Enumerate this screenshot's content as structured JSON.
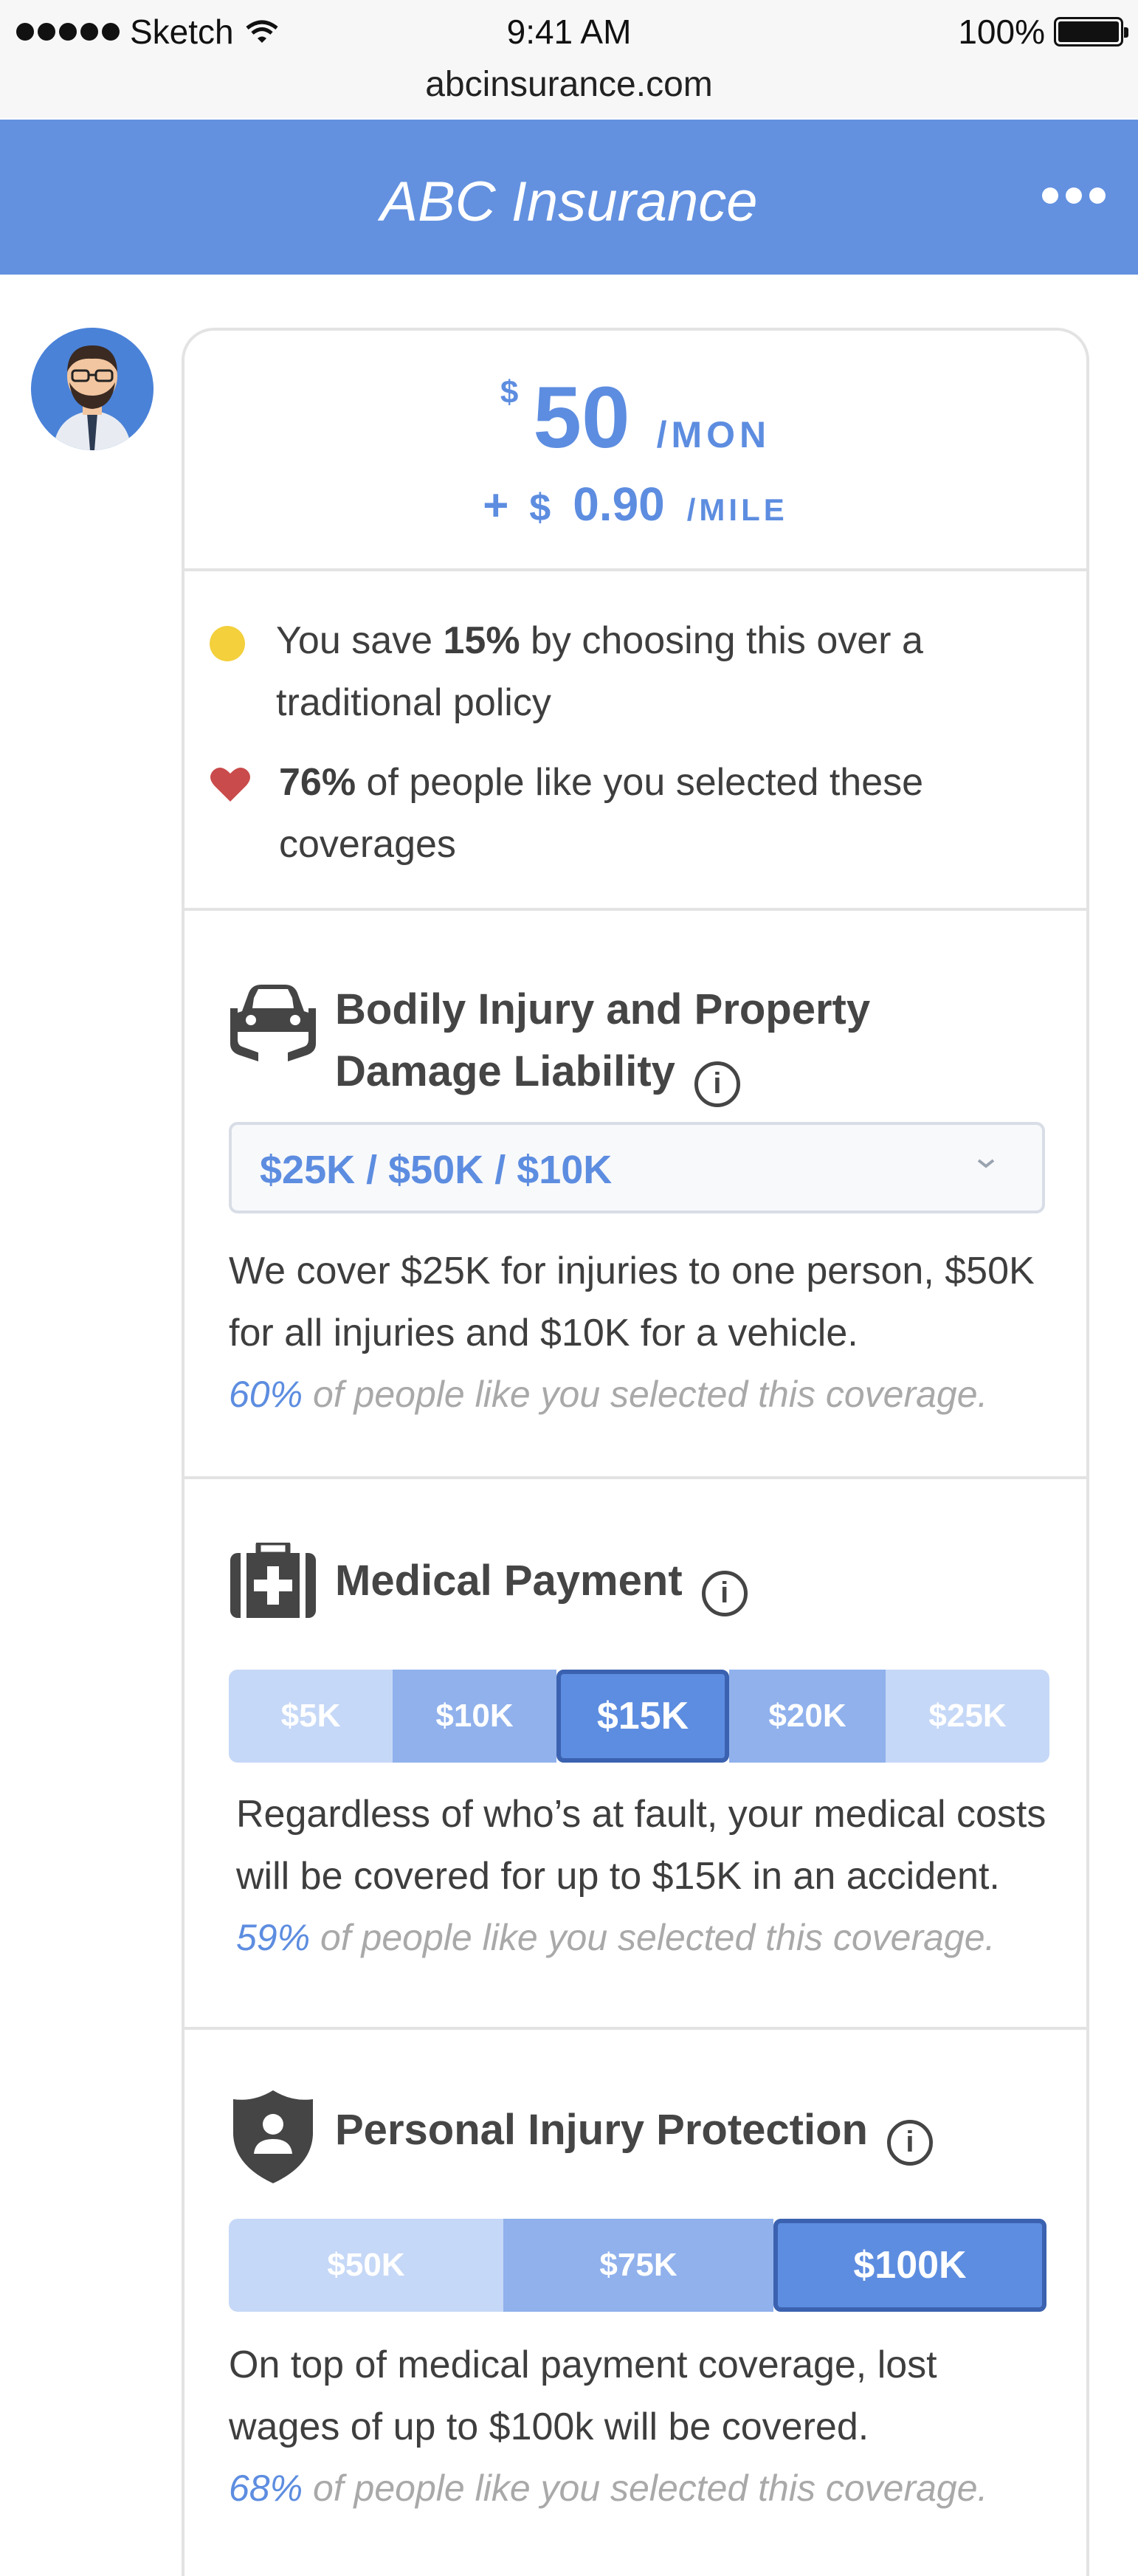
{
  "status_bar": {
    "carrier": "Sketch",
    "time": "9:41 AM",
    "battery": "100%"
  },
  "browser": {
    "url": "abcinsurance.com"
  },
  "header": {
    "title": "ABC Insurance"
  },
  "price": {
    "currency": "$",
    "monthly_amount": "50",
    "monthly_unit": "/MON",
    "plus": "+",
    "mile_currency": "$",
    "mile_amount": "0.90",
    "mile_unit": "/MILE"
  },
  "savings": {
    "save_pre": "You save ",
    "save_pct": "15%",
    "save_post": " by choosing this over a traditional policy",
    "popular_pct": "76%",
    "popular_post": " of people like you selected these coverages"
  },
  "coverages": [
    {
      "title": "Bodily Injury and Property Damage Liability",
      "selected": "$25K / $50K / $10K",
      "description": "We cover $25K for injuries to one person, $50K for all injuries and $10K for a vehicle.",
      "pct": "60%",
      "pct_text": " of people like you selected this coverage."
    },
    {
      "title": "Medical Payment",
      "options": [
        "$5K",
        "$10K",
        "$15K",
        "$20K",
        "$25K"
      ],
      "selected": "$15K",
      "description": "Regardless of who’s at fault, your medical costs will be covered for up to $15K in an accident.",
      "pct": "59%",
      "pct_text": " of people like you selected this coverage."
    },
    {
      "title": "Personal Injury Protection",
      "options": [
        "$50K",
        "$75K",
        "$100K"
      ],
      "selected": "$100K",
      "description": "On top of medical payment coverage, lost wages of up to $100k will be covered.",
      "pct": "68%",
      "pct_text": " of people like you selected this coverage."
    }
  ],
  "colors": {
    "brand": "#6391e0",
    "accent": "#5d8de0",
    "coin": "#f3d03c",
    "heart": "#c94b4b"
  },
  "icons": [
    "wifi-icon",
    "battery-icon",
    "more-icon",
    "avatar",
    "coin-icon",
    "heart-icon",
    "car-hands-icon",
    "medkit-icon",
    "shield-person-icon",
    "info-icon",
    "chevron-down-icon"
  ]
}
